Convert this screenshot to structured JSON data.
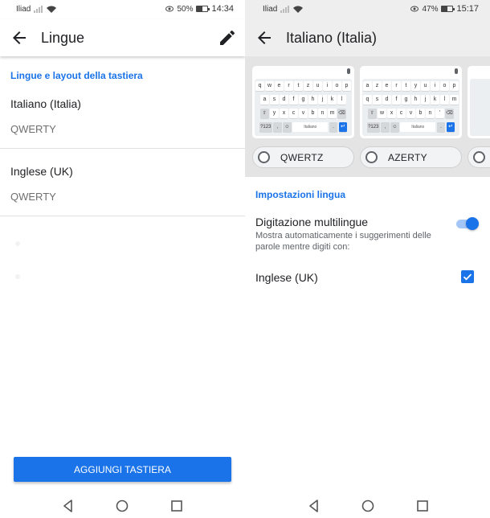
{
  "left": {
    "status": {
      "carrier": "Iliad",
      "battery": "50%",
      "battery_level": 0.5,
      "time": "14:34"
    },
    "appbar": {
      "title": "Lingue"
    },
    "section_header": "Lingue e layout della tastiera",
    "languages": [
      {
        "name": "Italiano (Italia)",
        "layout": "QWERTY"
      },
      {
        "name": "Inglese (UK)",
        "layout": "QWERTY"
      }
    ],
    "add_button": "AGGIUNGI TASTIERA"
  },
  "right": {
    "status": {
      "carrier": "Iliad",
      "battery": "47%",
      "battery_level": 0.47,
      "time": "15:17"
    },
    "appbar": {
      "title": "Italiano (Italia)"
    },
    "keyboards": [
      {
        "layout": "QWERTZ",
        "rows": [
          [
            "q",
            "w",
            "e",
            "r",
            "t",
            "z",
            "u",
            "i",
            "o",
            "p"
          ],
          [
            "a",
            "s",
            "d",
            "f",
            "g",
            "h",
            "j",
            "k",
            "l"
          ],
          [
            "⇧",
            "y",
            "x",
            "c",
            "v",
            "b",
            "n",
            "m",
            "⌫"
          ],
          [
            "?123",
            ",",
            "☺",
            "Italiano",
            ".",
            "↵"
          ]
        ]
      },
      {
        "layout": "AZERTY",
        "rows": [
          [
            "a",
            "z",
            "e",
            "r",
            "t",
            "y",
            "u",
            "i",
            "o",
            "p"
          ],
          [
            "q",
            "s",
            "d",
            "f",
            "g",
            "h",
            "j",
            "k",
            "l",
            "m"
          ],
          [
            "⇧",
            "w",
            "x",
            "c",
            "v",
            "b",
            "n",
            "'",
            "⌫"
          ],
          [
            "?123",
            ",",
            "☺",
            "Italiano",
            ".",
            "↵"
          ]
        ]
      }
    ],
    "settings_header": "Impostazioni lingua",
    "multilingual": {
      "title": "Digitazione multilingue",
      "subtitle": "Mostra automaticamente i suggerimenti delle parole mentre digiti con:",
      "enabled": true
    },
    "extra_language": {
      "name": "Inglese (UK)",
      "checked": true
    }
  },
  "icons": {
    "back": "arrow-back-icon",
    "edit": "pencil-icon",
    "nav_back": "triangle-back-icon",
    "nav_home": "circle-home-icon",
    "nav_recents": "square-recents-icon"
  },
  "colors": {
    "accent": "#1a73e8",
    "carousel_bg": "#e4e4e4"
  }
}
